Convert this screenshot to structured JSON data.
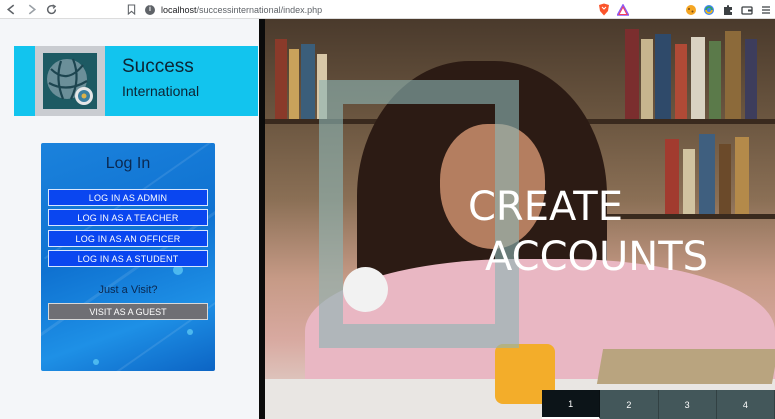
{
  "browser": {
    "url_host": "localhost",
    "url_path": "/successinternational/index.php",
    "icons": [
      "back-icon",
      "forward-icon",
      "reload-icon",
      "bookmark-icon",
      "info-icon",
      "brave-shield-icon",
      "brave-rewards-icon",
      "extension-cookie-icon",
      "extension-sync-icon",
      "puzzle-icon",
      "wallet-icon",
      "menu-icon"
    ]
  },
  "brand": {
    "name": "Success",
    "subtitle": "International"
  },
  "login": {
    "title": "Log In",
    "buttons": [
      "LOG IN AS ADMIN",
      "LOG IN AS A TEACHER",
      "LOG IN AS AN OFFICER",
      "LOG IN AS A STUDENT"
    ],
    "visit_label": "Just a Visit?",
    "guest_button": "VISIT AS A GUEST"
  },
  "hero": {
    "line1": "CREATE",
    "line2": "ACCOUNTS"
  },
  "slider": {
    "tabs": [
      "1",
      "2",
      "3",
      "4"
    ],
    "active_index": 0
  },
  "colors": {
    "banner": "#12c4ee",
    "login_button": "#0a46f0",
    "guest_button": "#6f6f74",
    "card": "#1b82dc"
  }
}
